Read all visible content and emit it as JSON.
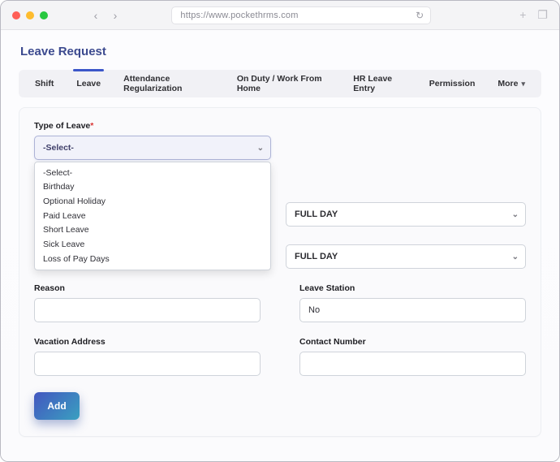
{
  "browser": {
    "url": "https://www.pockethrms.com"
  },
  "page": {
    "title": "Leave Request"
  },
  "tabs": {
    "items": [
      {
        "label": "Shift"
      },
      {
        "label": "Leave",
        "active": true
      },
      {
        "label": "Attendance Regularization"
      },
      {
        "label": "On Duty / Work From Home"
      },
      {
        "label": "HR Leave Entry"
      },
      {
        "label": "Permission"
      },
      {
        "label": "More"
      }
    ]
  },
  "form": {
    "type_of_leave": {
      "label": "Type of Leave",
      "required": true,
      "selected": "-Select-",
      "options": [
        "-Select-",
        "Birthday",
        "Optional Holiday",
        "Paid Leave",
        "Short Leave",
        "Sick Leave",
        "Loss of Pay Days"
      ]
    },
    "full_day_1": "FULL DAY",
    "full_day_2": "FULL DAY",
    "reason_label": "Reason",
    "leave_station_label": "Leave Station",
    "leave_station_value": "No",
    "vacation_address_label": "Vacation Address",
    "contact_number_label": "Contact Number",
    "add_button": "Add"
  }
}
